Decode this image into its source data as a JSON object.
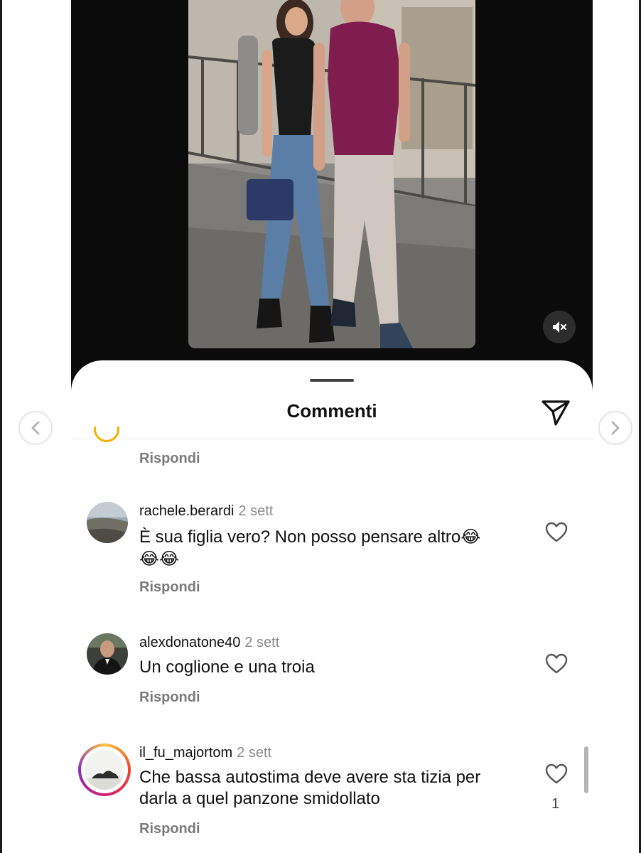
{
  "sheet": {
    "title": "Commenti",
    "send_icon": "paper-plane-icon"
  },
  "story": {
    "mute_icon": "speaker-muted-icon"
  },
  "navigation": {
    "prev_icon": "chevron-left-icon",
    "next_icon": "chevron-right-icon"
  },
  "reply_label": "Rispondi",
  "comments": [
    {
      "username": "rachele.berardi",
      "time": "2 sett",
      "text_line1": "È sua figlia vero? Non posso pensare altro",
      "text_emoji_inline": "😂",
      "text_line2_emoji": "😂😂",
      "likes": ""
    },
    {
      "username": "alexdonatone40",
      "time": "2 sett",
      "text_line1": "Un coglione e una troia",
      "likes": ""
    },
    {
      "username": "il_fu_majortom",
      "time": "2 sett",
      "text_line1": "Che bassa autostima deve avere sta tizia per",
      "text_line2": "darla a quel panzone smidollato",
      "likes": "1"
    }
  ],
  "colors": {
    "story_bg": "#0b0b0b",
    "muted_text": "#7a7a7a",
    "story_ring": "#d1206f"
  }
}
